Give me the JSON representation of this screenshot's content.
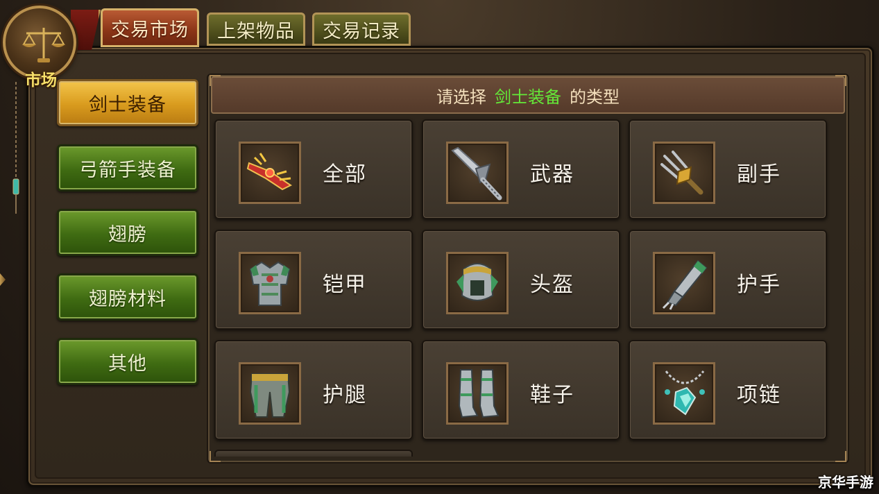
{
  "badge": {
    "label": "市场"
  },
  "tabs": [
    {
      "label": "交易市场",
      "active": true
    },
    {
      "label": "上架物品",
      "active": false
    },
    {
      "label": "交易记录",
      "active": false
    }
  ],
  "categories": [
    {
      "label": "剑士装备",
      "active": true
    },
    {
      "label": "弓箭手装备",
      "active": false
    },
    {
      "label": "翅膀",
      "active": false
    },
    {
      "label": "翅膀材料",
      "active": false
    },
    {
      "label": "其他",
      "active": false
    }
  ],
  "header": {
    "prefix": "请选择",
    "highlight": "剑士装备",
    "suffix": "的类型"
  },
  "items": [
    {
      "label": "全部",
      "icon": "crossguard-icon"
    },
    {
      "label": "武器",
      "icon": "sword-icon"
    },
    {
      "label": "副手",
      "icon": "trident-icon"
    },
    {
      "label": "铠甲",
      "icon": "armor-icon"
    },
    {
      "label": "头盔",
      "icon": "helmet-icon"
    },
    {
      "label": "护手",
      "icon": "gauntlet-icon"
    },
    {
      "label": "护腿",
      "icon": "greaves-icon"
    },
    {
      "label": "鞋子",
      "icon": "boots-icon"
    },
    {
      "label": "项链",
      "icon": "necklace-icon"
    }
  ],
  "colors": {
    "highlight": "#64e838",
    "active_tab": "#8a3417",
    "active_category": "#d99b1e",
    "category": "#3f6b12"
  },
  "watermark": "京华手游"
}
